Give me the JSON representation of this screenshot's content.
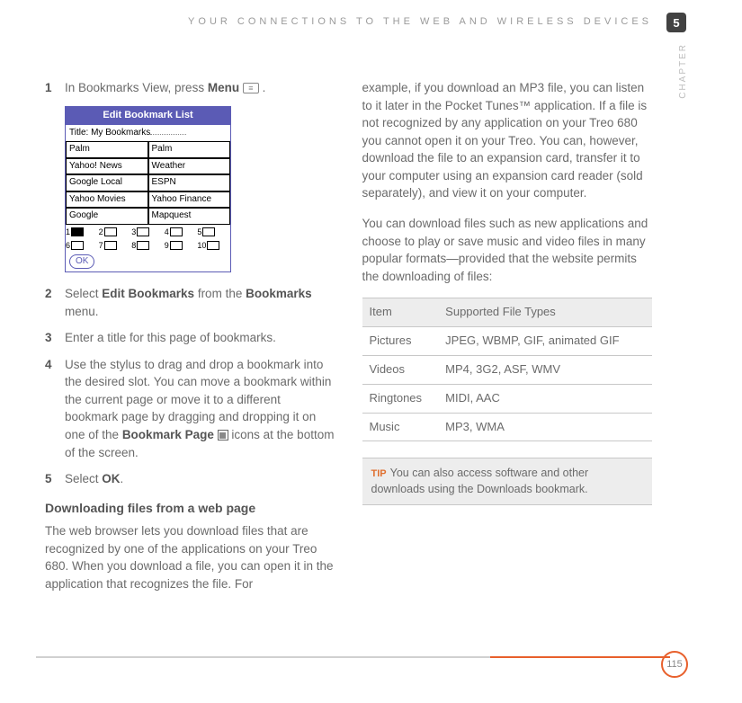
{
  "header": "YOUR CONNECTIONS TO THE WEB AND WIRELESS DEVICES",
  "chapter_num": "5",
  "chapter_label": "CHAPTER",
  "page_number": "115",
  "left": {
    "step1": {
      "num": "1",
      "pre": "In Bookmarks View, press ",
      "bold": "Menu",
      "post": " ."
    },
    "screenshot": {
      "title": "Edit Bookmark List",
      "subtitle_label": "Title:",
      "subtitle_value": "My Bookmarks",
      "rows": [
        [
          "Palm",
          "Palm"
        ],
        [
          "Yahoo! News",
          "Weather"
        ],
        [
          "Google Local",
          "ESPN"
        ],
        [
          "Yahoo Movies",
          "Yahoo Finance"
        ],
        [
          "Google",
          "Mapquest"
        ]
      ],
      "nums1": [
        "1",
        "2",
        "3",
        "4",
        "5"
      ],
      "nums2": [
        "6",
        "7",
        "8",
        "9",
        "10"
      ],
      "ok": "OK"
    },
    "step2": {
      "num": "2",
      "pre": "Select ",
      "b1": "Edit Bookmarks",
      "mid": " from the ",
      "b2": "Bookmarks",
      "post": " menu."
    },
    "step3": {
      "num": "3",
      "text": "Enter a title for this page of bookmarks."
    },
    "step4": {
      "num": "4",
      "pre": "Use the stylus to drag and drop a bookmark into the desired slot. You can move a bookmark within the current page or move it to a different bookmark page by dragging and dropping it on one of the ",
      "b": "Bookmark Page",
      "post": " icons at the bottom of the screen."
    },
    "step5": {
      "num": "5",
      "pre": "Select ",
      "b": "OK",
      "post": "."
    },
    "heading": "Downloading files from a web page",
    "para": "The web browser lets you download files that are recognized by one of the applications on your Treo 680. When you download a file, you can open it in the application that recognizes the file. For"
  },
  "right": {
    "para1": "example, if you download an MP3 file, you can listen to it later in the Pocket Tunes™ application. If a file is not recognized by any application on your Treo 680 you cannot open it on your Treo. You can, however, download the file to an expansion card, transfer it to your computer using an expansion card reader (sold separately), and view it on your computer.",
    "para2": "You can download files such as new applications and choose to play or save music and video files in many popular formats—provided that the website permits the downloading of files:",
    "table": {
      "head": [
        "Item",
        "Supported File Types"
      ],
      "rows": [
        [
          "Pictures",
          "JPEG, WBMP, GIF, animated GIF"
        ],
        [
          "Videos",
          "MP4, 3G2, ASF, WMV"
        ],
        [
          "Ringtones",
          "MIDI, AAC"
        ],
        [
          "Music",
          "MP3, WMA"
        ]
      ]
    },
    "tip": {
      "label": "TIP",
      "text": "You can also access software and other downloads using the Downloads bookmark."
    }
  }
}
